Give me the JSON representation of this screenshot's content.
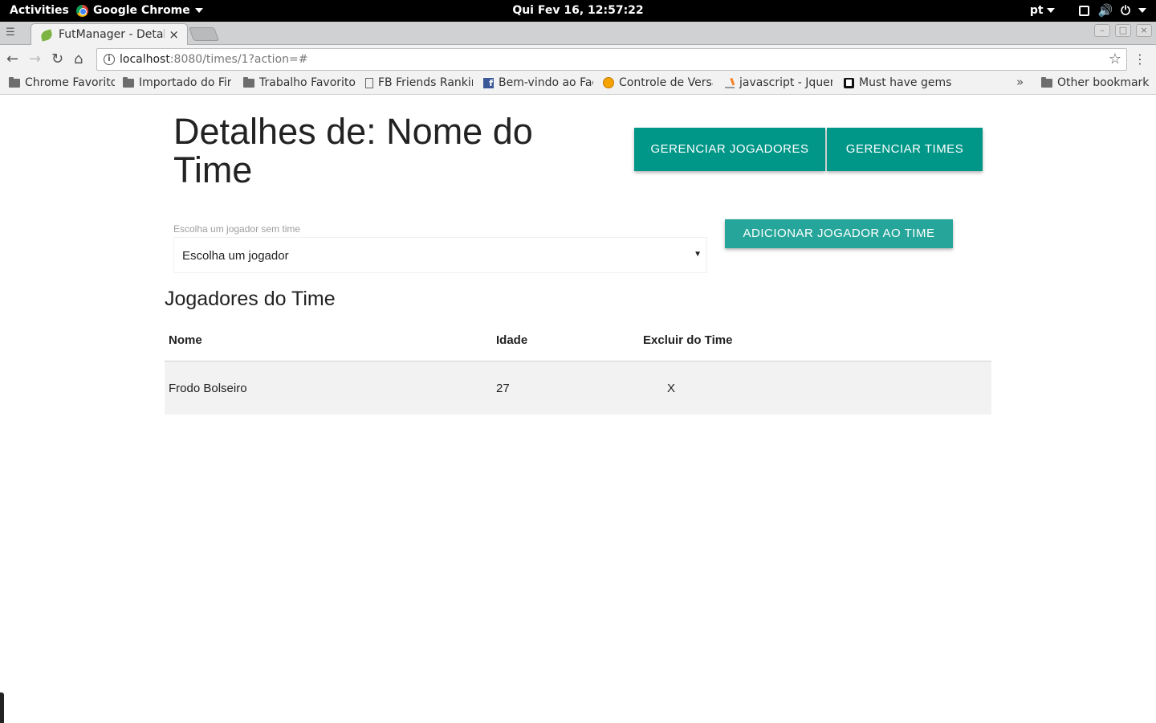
{
  "system_bar": {
    "activities": "Activities",
    "app_name": "Google Chrome",
    "clock": "Qui Fev 16, 12:57:22",
    "language": "pt"
  },
  "browser": {
    "tab_title": "FutManager - Detalhes",
    "tab_close": "×",
    "url_host": "localhost",
    "url_rest": ":8080/times/1?action=#",
    "bookmarks": [
      {
        "label": "Chrome Favoritos",
        "icon": "folder-icon"
      },
      {
        "label": "Importado do Firefox",
        "icon": "folder-icon"
      },
      {
        "label": "Trabalho Favoritos",
        "icon": "folder-icon"
      },
      {
        "label": "FB Friends Ranking",
        "icon": "page-icon"
      },
      {
        "label": "Bem-vindo ao Facebook",
        "icon": "facebook-icon"
      },
      {
        "label": "Controle de Versão",
        "icon": "globe-icon"
      },
      {
        "label": "javascript - Jquery",
        "icon": "stackoverflow-icon"
      },
      {
        "label": "Must have gems for",
        "icon": "bookmark-icon"
      }
    ],
    "other_bookmarks": "Other bookmarks",
    "overflow": "»"
  },
  "page": {
    "title": "Detalhes de: Nome do Time",
    "buttons": {
      "manage_players": "GERENCIAR JOGADORES",
      "manage_teams": "GERENCIAR TIMES",
      "add_player": "ADICIONAR JOGADOR AO TIME"
    },
    "select": {
      "label": "Escolha um jogador sem time",
      "value": "Escolha um jogador"
    },
    "section_title": "Jogadores do Time",
    "table": {
      "headers": [
        "Nome",
        "Idade",
        "Excluir do Time"
      ],
      "rows": [
        {
          "name": "Frodo Bolseiro",
          "age": "27",
          "remove": "X"
        }
      ]
    }
  },
  "colors": {
    "primary_button": "#009688",
    "secondary_button": "#26a69a"
  }
}
